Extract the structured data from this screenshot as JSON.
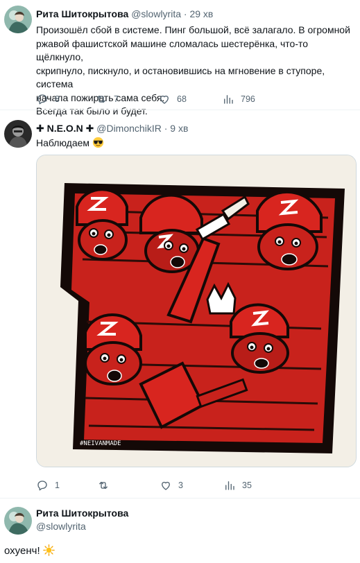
{
  "tweets": [
    {
      "name": "Рита Шитокрытова",
      "handle": "@slowlyrita",
      "time": "29 хв",
      "text_lines": [
        "Произошёл сбой в системе. Пинг большой, всё залагало. В огромной",
        "ржавой фашистской машине сломалась шестерёнка, что-то щёлкнуло,",
        "скрипнуло, пискнуло, и остановившись на мгновение в ступоре, система",
        "начала пожирать сама себя.",
        "Всегда так было и будет."
      ],
      "replies": "8",
      "retweets": "7",
      "likes": "68",
      "views": "796"
    },
    {
      "name": "✚ N.E.O.N ✚",
      "handle": "@DimonchikIR",
      "time": "9 хв",
      "text": "Наблюдаем",
      "image_watermark": "#NEIVANMADE",
      "replies": "1",
      "retweets": "",
      "likes": "3",
      "views": "35"
    },
    {
      "name": "Рита Шитокрытова",
      "handle": "@slowlyrita",
      "text": "охуенч!"
    }
  ],
  "separator": "·",
  "icons": [
    "reply-icon",
    "retweet-icon",
    "like-icon",
    "views-icon",
    "sunglasses-emoji-icon",
    "sun-emoji-icon"
  ],
  "colors": {
    "text": "#0f1419",
    "secondary": "#536471",
    "art_red": "#d8251f",
    "art_dark": "#1a0c0a"
  }
}
